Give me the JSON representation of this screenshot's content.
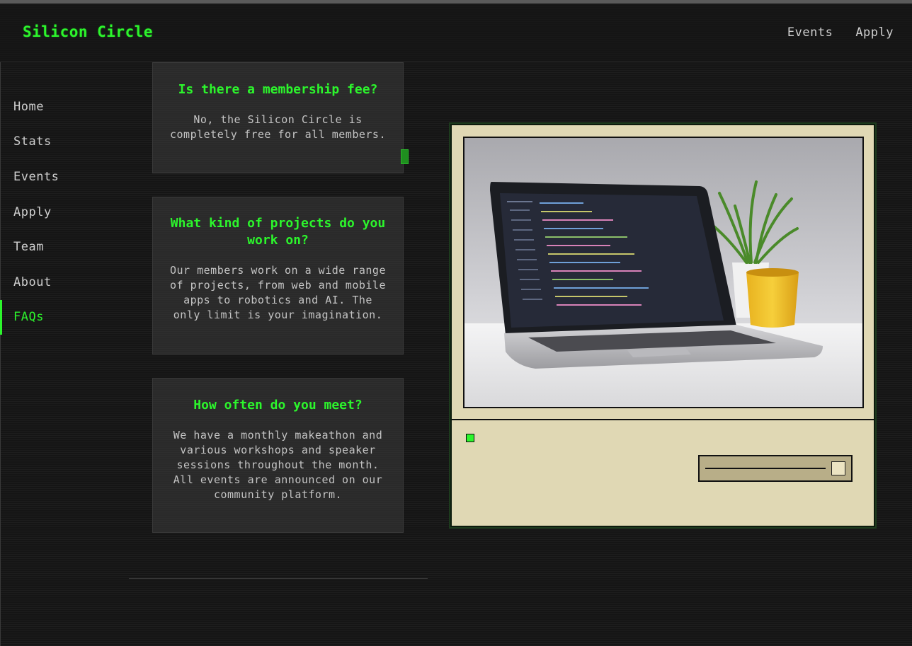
{
  "brand": {
    "name": "Silicon Circle"
  },
  "topnav": {
    "items": [
      "Events",
      "Apply"
    ]
  },
  "sidebar": {
    "items": [
      "Home",
      "Stats",
      "Events",
      "Apply",
      "Team",
      "About",
      "FAQs"
    ],
    "active": "FAQs"
  },
  "faqs": [
    {
      "question": "Is there a membership fee?",
      "answer": "No, the Silicon Circle is completely free for all members."
    },
    {
      "question": "What kind of projects do you work on?",
      "answer": "Our members work on a wide range of projects, from web and mobile apps to robotics and AI. The only limit is your imagination."
    },
    {
      "question": "How often do you meet?",
      "answer": "We have a monthly makeathon and various workshops and speaker sessions throughout the month. All events are announced on our community platform."
    }
  ],
  "monitor": {
    "screen_image": "laptop-on-desk-with-code-and-plant-photo",
    "power_led_color": "#2cf52c",
    "slider_value": 1.0
  },
  "colors": {
    "accent": "#2cf52c",
    "background": "#151515",
    "monitor_body": "#e0d8b4"
  }
}
